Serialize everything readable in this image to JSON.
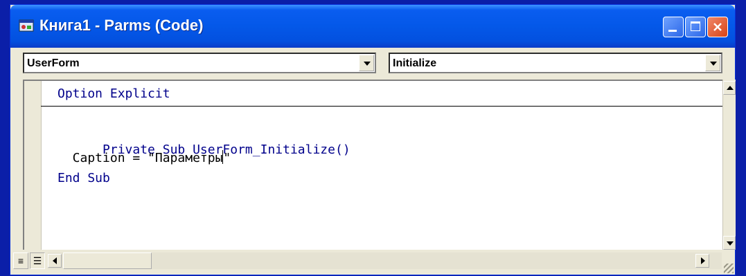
{
  "window": {
    "title": "Книга1 - Parms (Code)",
    "icon": "userform-icon",
    "buttons": {
      "minimize": "minimize-icon",
      "maximize": "maximize-icon",
      "close": "close-icon"
    }
  },
  "combos": {
    "object": {
      "value": "UserForm"
    },
    "procedure": {
      "value": "Initialize"
    }
  },
  "code": {
    "lines": [
      {
        "a": "Option Explicit",
        "b": "",
        "c": ""
      },
      {
        "a": "Private Sub UserForm_Initialize()",
        "b": "",
        "c": ""
      },
      {
        "a": "  Caption = \"Параметры",
        "b": "\"",
        "c": ""
      },
      {
        "a": "End Sub",
        "b": "",
        "c": ""
      }
    ]
  },
  "colors": {
    "titlebar": "#0458e8",
    "desktop": "#0b1fa8",
    "keyword": "#00008b"
  }
}
